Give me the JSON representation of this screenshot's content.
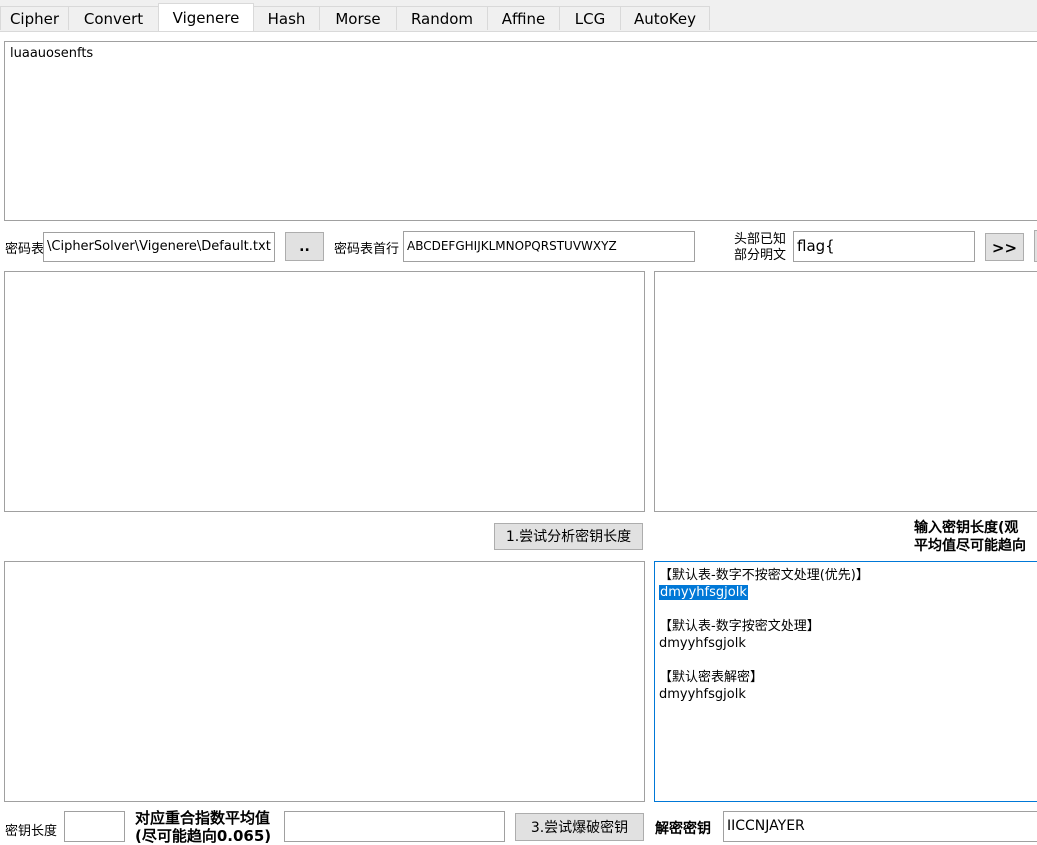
{
  "tabs": [
    "Cipher",
    "Convert",
    "Vigenere",
    "Hash",
    "Morse",
    "Random",
    "Affine",
    "LCG",
    "AutoKey"
  ],
  "active_tab": "Vigenere",
  "ciphertext": "luaauosenfts",
  "table_label": "密码表",
  "table_path": "\\CipherSolver\\Vigenere\\Default.txt",
  "browse_label": "..",
  "first_row_label": "密码表首行",
  "first_row_value": "ABCDEFGHIJKLMNOPQRSTUVWXYZ",
  "known_plain_label_1": "头部已知",
  "known_plain_label_2": "部分明文",
  "known_plain_value": "flag{",
  "known_plain_button": ">>",
  "analyze_button": "1.尝试分析密钥长度",
  "keylen_hint_1": "输入密钥长度(观",
  "keylen_hint_2": "平均值尽可能趋向",
  "results": [
    {
      "header": "【默认表-数字不按密文处理(优先)】",
      "value": "dmyyhfsgjolk",
      "selected": true
    },
    {
      "header": "【默认表-数字按密文处理】",
      "value": "dmyyhfsgjolk",
      "selected": false
    },
    {
      "header": "【默认密表解密】",
      "value": "dmyyhfsgjolk",
      "selected": false
    }
  ],
  "key_length_label": "密钥长度",
  "key_length_value": "",
  "ic_label_1": "对应重合指数平均值",
  "ic_label_2": "(尽可能趋向0.065)",
  "ic_value": "",
  "brute_button": "3.尝试爆破密钥",
  "decrypt_key_label": "解密密钥",
  "decrypt_key_value": "IICCNJAYER"
}
